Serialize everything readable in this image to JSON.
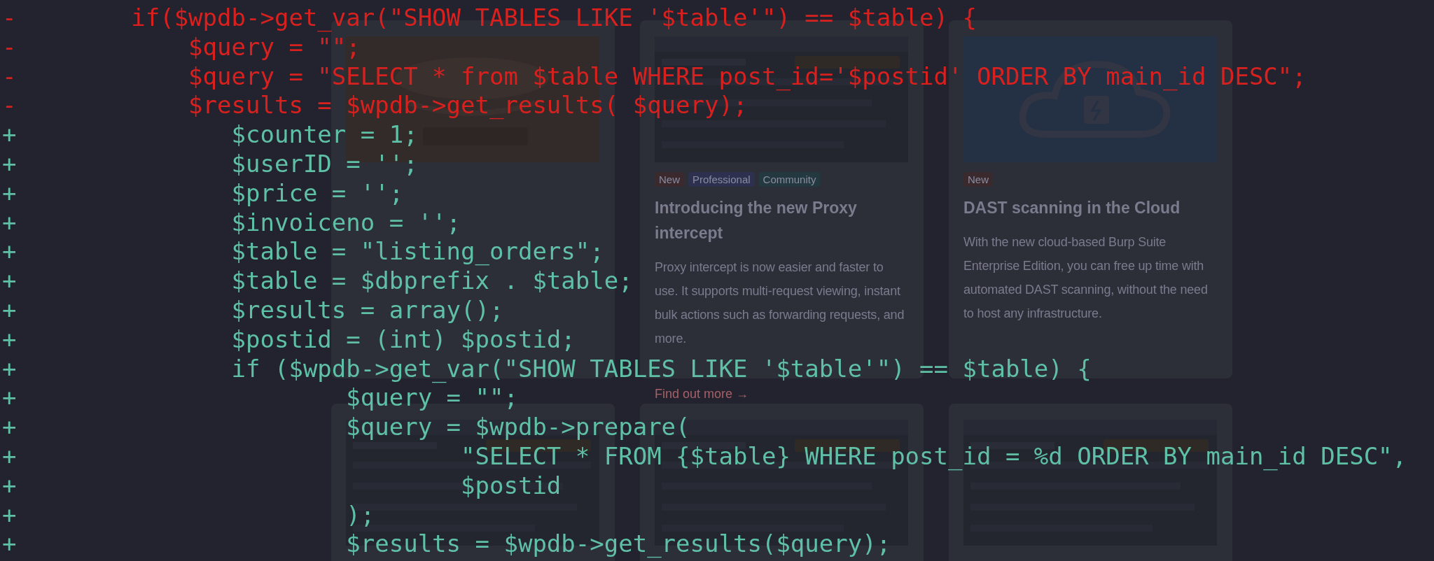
{
  "cards": [
    {
      "image": {
        "kind": "picture"
      }
    },
    {
      "image": {
        "kind": "picture"
      },
      "tags": [
        {
          "label": "New",
          "color": "#3a2a2e"
        },
        {
          "label": "Professional",
          "color": "#2e3050"
        },
        {
          "label": "Community",
          "color": "#24393f"
        }
      ],
      "title": "Introducing the new Proxy intercept",
      "description": "Proxy intercept is now easier and faster to use. It supports multi-request viewing, instant bulk actions such as forwarding requests, and more.",
      "link": "Find out more →"
    },
    {
      "image": {
        "kind": "picture"
      },
      "tags": [
        {
          "label": "New",
          "color": "#3a2a2e"
        }
      ],
      "title": "DAST scanning in the Cloud",
      "description": "With the new cloud-based Burp Suite Enterprise Edition, you can free up time with automated DAST scanning, without the need to host any infrastructure."
    }
  ],
  "more_cards": [
    {
      "image": {
        "kind": "picture"
      }
    },
    {
      "image": {
        "kind": "picture"
      }
    },
    {
      "image": {
        "kind": "picture"
      }
    }
  ],
  "diff": {
    "lines": [
      {
        "kind": "removed",
        "sign": "-",
        "code": "        if($wpdb->get_var(\"SHOW TABLES LIKE '$table'\") == $table) {"
      },
      {
        "kind": "removed",
        "sign": "-",
        "code": "            $query = \"\";"
      },
      {
        "kind": "removed",
        "sign": "-",
        "code": "            $query = \"SELECT * from $table WHERE post_id='$postid' ORDER BY main_id DESC\";"
      },
      {
        "kind": "removed",
        "sign": "-",
        "code": "            $results = $wpdb->get_results( $query);"
      },
      {
        "kind": "added",
        "sign": "+",
        "code": "               $counter = 1;"
      },
      {
        "kind": "added",
        "sign": "+",
        "code": "               $userID = '';"
      },
      {
        "kind": "added",
        "sign": "+",
        "code": "               $price = '';"
      },
      {
        "kind": "added",
        "sign": "+",
        "code": "               $invoiceno = '';"
      },
      {
        "kind": "added",
        "sign": "+",
        "code": "               $table = \"listing_orders\";"
      },
      {
        "kind": "added",
        "sign": "+",
        "code": "               $table = $dbprefix . $table;"
      },
      {
        "kind": "added",
        "sign": "+",
        "code": "               $results = array();"
      },
      {
        "kind": "added",
        "sign": "+",
        "code": "               $postid = (int) $postid;"
      },
      {
        "kind": "added",
        "sign": "+",
        "code": "               if ($wpdb->get_var(\"SHOW TABLES LIKE '$table'\") == $table) {"
      },
      {
        "kind": "added",
        "sign": "+",
        "code": "                       $query = \"\";"
      },
      {
        "kind": "added",
        "sign": "+",
        "code": "                       $query = $wpdb->prepare("
      },
      {
        "kind": "added",
        "sign": "+",
        "code": "                               \"SELECT * FROM {$table} WHERE post_id = %d ORDER BY main_id DESC\","
      },
      {
        "kind": "added",
        "sign": "+",
        "code": "                               $postid"
      },
      {
        "kind": "added",
        "sign": "+",
        "code": "                       );"
      },
      {
        "kind": "added",
        "sign": "+",
        "code": "                       $results = $wpdb->get_results($query);"
      }
    ]
  }
}
